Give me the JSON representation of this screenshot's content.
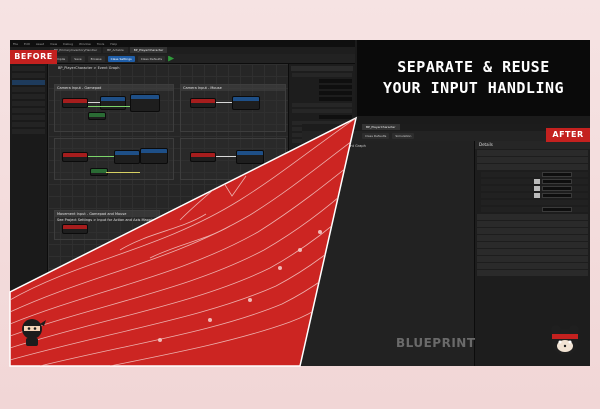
{
  "headline": {
    "line1": "SEPARATE & REUSE",
    "line2": "YOUR INPUT HANDLING"
  },
  "tags": {
    "before": "BEFORE",
    "after": "AFTER"
  },
  "watermark": "BLUEPRINT",
  "before_editor": {
    "menu": [
      "File",
      "Edit",
      "Asset",
      "View",
      "Debug",
      "Window",
      "Tools",
      "Help"
    ],
    "tabs": [
      "BP_PrimaryInventoryHandler",
      "BP_Actable",
      "BP_PlayerCharacter"
    ],
    "toolbar": [
      "Compile",
      "Save",
      "Browse",
      "Find",
      "Hide Unrelated",
      "Class Settings",
      "Class Defaults",
      "Simulation"
    ],
    "breadcrumb": "BP_PlayerCharacter > Event Graph",
    "comments": [
      {
        "title": "Camera Input - Gamepad"
      },
      {
        "title": "Camera Input - Mouse"
      },
      {
        "title": "Movement Input - Gamepad and Mouse",
        "subtitle": "See Project Settings > Input for Action and Axis Mappings"
      }
    ]
  },
  "after_editor": {
    "tab": "BP_PlayerCharacter",
    "toolbar": [
      "Class Defaults",
      "Simulation"
    ],
    "graph_label": "Event Graph",
    "details": {
      "header": "Details",
      "categories": [
        "Variable",
        "Tick",
        "Input",
        "Tags",
        "Component Tick",
        "Component Replication",
        "Activation",
        "Cooking",
        "Collision",
        "Asset User Data",
        "Rendering",
        "Collision"
      ]
    }
  },
  "colors": {
    "accent_red": "#c4211f",
    "editor_bg": "#151515",
    "banner_bg": "#0a0a0a",
    "page_bg": "#f3dede"
  }
}
